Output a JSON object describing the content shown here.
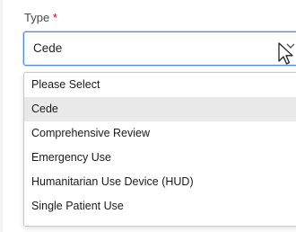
{
  "field": {
    "label": "Type",
    "required_mark": "*"
  },
  "select": {
    "value": "Cede"
  },
  "dropdown": {
    "options": [
      {
        "label": "Please Select"
      },
      {
        "label": "Cede"
      },
      {
        "label": "Comprehensive Review"
      },
      {
        "label": "Emergency Use"
      },
      {
        "label": "Humanitarian Use Device (HUD)"
      },
      {
        "label": "Single Patient Use"
      }
    ],
    "selected_option": "Cede"
  },
  "colors": {
    "focus_border": "#4a90d9",
    "required": "#d0021b",
    "selected_bg": "#e9e9e9"
  },
  "icons": {
    "chevron": "chevron-down-icon",
    "cursor": "mouse-pointer-icon"
  }
}
